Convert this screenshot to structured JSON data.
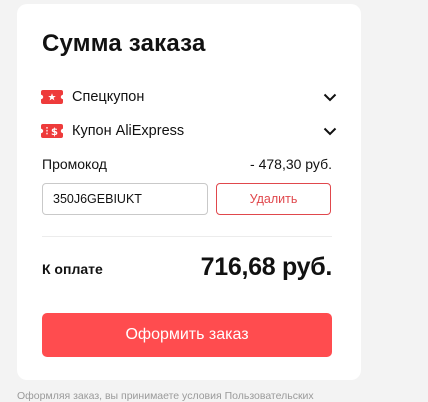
{
  "summary": {
    "title": "Сумма заказа",
    "coupons": [
      {
        "label": "Спецкупон",
        "icon": "special-coupon-icon"
      },
      {
        "label": "Купон AliExpress",
        "icon": "aliexpress-coupon-icon"
      }
    ],
    "promo": {
      "label": "Промокод",
      "discount": "- 478,30 руб.",
      "code": "350J6GEBIUKT",
      "delete_label": "Удалить"
    },
    "total": {
      "label": "К оплате",
      "amount": "716,68 руб."
    },
    "checkout_label": "Оформить заказ",
    "footer_note": "Оформляя заказ, вы принимаете условия Пользовательских"
  },
  "colors": {
    "accent": "#ff4c4f",
    "coupon_icon": "#ee3b3b",
    "background": "#f3f3f3"
  }
}
